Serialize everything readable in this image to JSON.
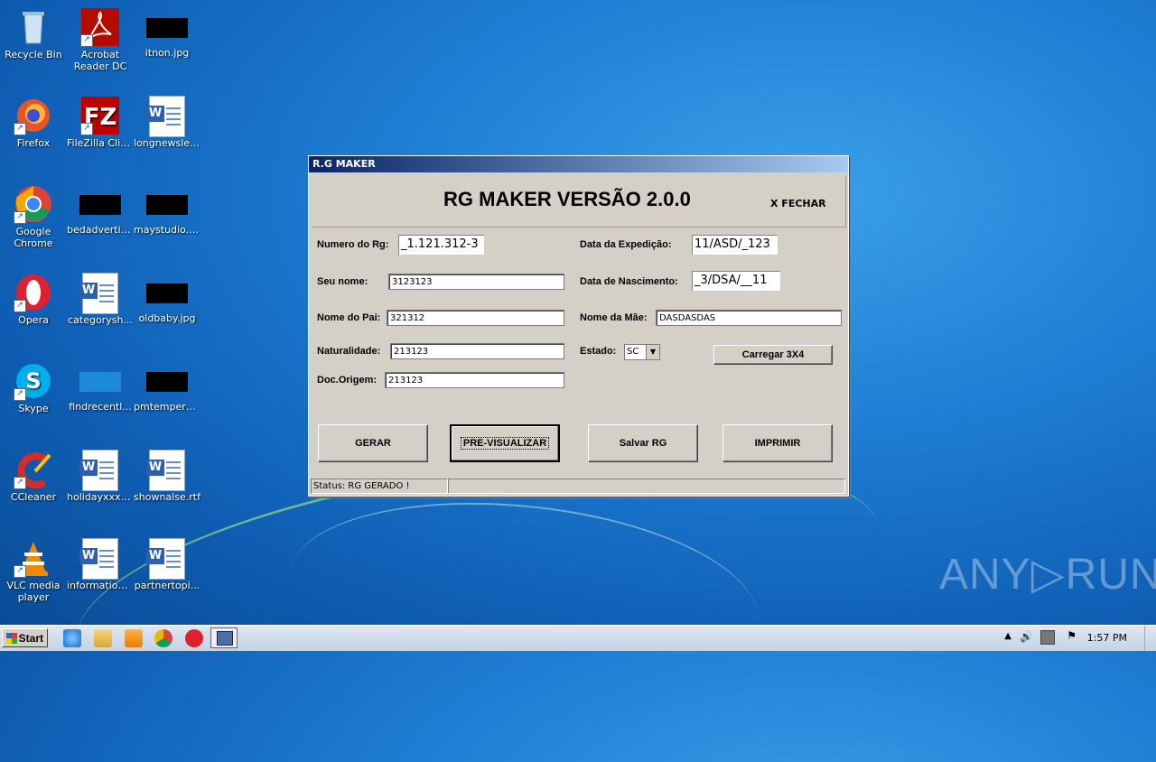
{
  "desktop": {
    "icons": [
      {
        "label": "Recycle Bin"
      },
      {
        "label": "Acrobat Reader DC"
      },
      {
        "label": "itnon.jpg"
      },
      {
        "label": "Firefox"
      },
      {
        "label": "FileZilla Client"
      },
      {
        "label": "longnewslet..."
      },
      {
        "label": "Google Chrome"
      },
      {
        "label": "bedadvertis..."
      },
      {
        "label": "maystudio.jpg"
      },
      {
        "label": "Opera"
      },
      {
        "label": "categorysh..."
      },
      {
        "label": "oldbaby.jpg"
      },
      {
        "label": "Skype"
      },
      {
        "label": "findrecentl..."
      },
      {
        "label": "pmtempera..."
      },
      {
        "label": "CCleaner"
      },
      {
        "label": "holidayxxx.rtf"
      },
      {
        "label": "shownalse.rtf"
      },
      {
        "label": "VLC media player"
      },
      {
        "label": "informationi..."
      },
      {
        "label": "partnertopi..."
      }
    ]
  },
  "window": {
    "title": "R.G MAKER",
    "heading": "RG MAKER VERSÃO 2.0.0",
    "close_label": "X FECHAR",
    "fields": {
      "numero_rg": {
        "label": "Numero do Rg:",
        "value": "_1.121.312-3"
      },
      "seu_nome": {
        "label": "Seu nome:",
        "value": "3123123"
      },
      "nome_pai": {
        "label": "Nome do Pai:",
        "value": "321312"
      },
      "naturalidade": {
        "label": "Naturalidade:",
        "value": "213123"
      },
      "doc_origem": {
        "label": "Doc.Origem:",
        "value": "213123"
      },
      "data_expedicao": {
        "label": "Data da Expedição:",
        "value": "11/ASD/_123"
      },
      "data_nascimento": {
        "label": "Data de Nascimento:",
        "value": "_3/DSA/__11"
      },
      "nome_mae": {
        "label": "Nome da Mãe:",
        "value": "DASDASDAS"
      },
      "estado": {
        "label": "Estado:",
        "value": "SC"
      }
    },
    "buttons": {
      "carregar": "Carregar  3X4",
      "gerar": "GERAR",
      "previsualizar": "PRE-VISUALIZAR",
      "salvar": "Salvar RG",
      "imprimir": "IMPRIMIR"
    },
    "status": "Status: RG GERADO !"
  },
  "taskbar": {
    "start_label": "Start",
    "clock": "1:57 PM"
  },
  "watermark": "ANY▷RUN"
}
